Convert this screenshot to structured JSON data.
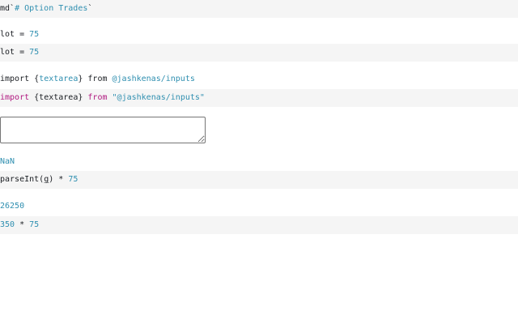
{
  "cells": [
    {
      "code": {
        "prefix": "md`",
        "title": "# Option Trades",
        "suffix": "`"
      }
    },
    {
      "output": {
        "name": "lot",
        "eq": " = ",
        "value": "75"
      },
      "code": {
        "name": "lot",
        "eq": " = ",
        "value": "75"
      }
    },
    {
      "output": {
        "kw1": "import ",
        "open": "{",
        "name": "textarea",
        "close": "}",
        "kw2": " from ",
        "module": "@jashkenas/inputs"
      },
      "code": {
        "kw1": "import",
        "space1": " ",
        "open": "{textarea}",
        "kw2": "from",
        "space2": " ",
        "module": "\"@jashkenas/inputs\""
      }
    },
    {
      "output": {
        "textarea_value": ""
      },
      "code": {
        "nan": "NaN"
      }
    },
    {
      "code": {
        "fn": "parseInt",
        "open": "(",
        "arg": "g",
        "close": ")",
        "op": " * ",
        "value": "75"
      }
    },
    {
      "output": {
        "value": "26250"
      },
      "code": {
        "left": "350",
        "op": " * ",
        "right": "75"
      }
    }
  ]
}
